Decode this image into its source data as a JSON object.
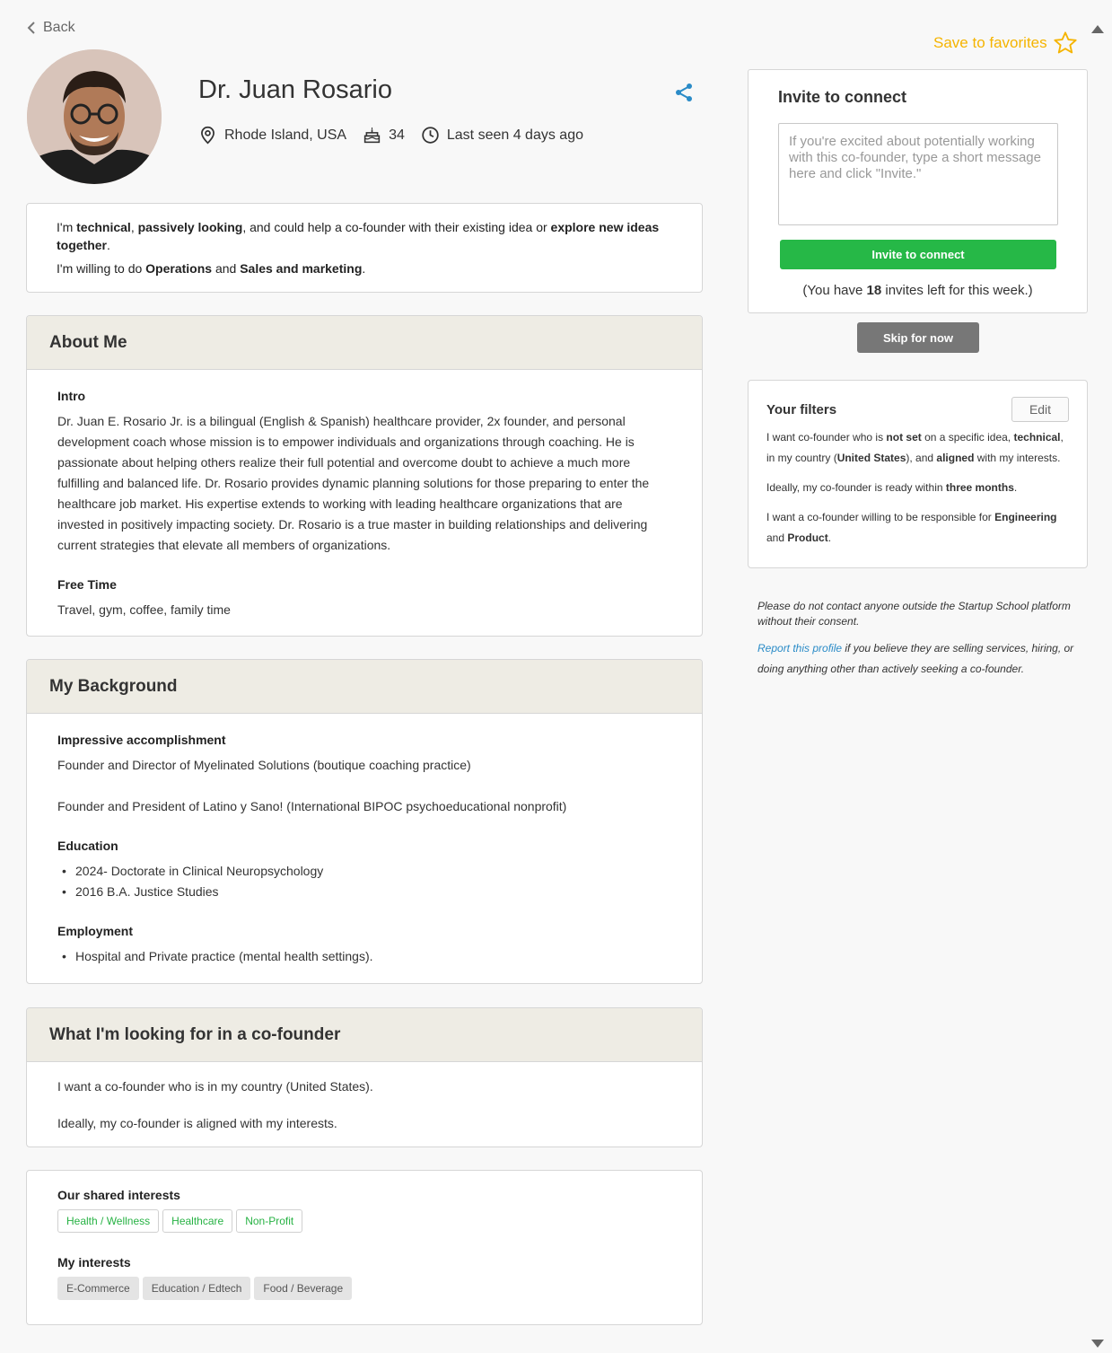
{
  "nav": {
    "back_label": "Back"
  },
  "profile": {
    "name": "Dr. Juan Rosario",
    "location": "Rhode Island, USA",
    "age": "34",
    "last_seen": "Last seen 4 days ago"
  },
  "summary": {
    "line1_a": "I'm ",
    "line1_b": "technical",
    "line1_c": ", ",
    "line1_d": "passively looking",
    "line1_e": ", and could help a co-founder with their existing idea or ",
    "line1_f": "explore new ideas together",
    "line1_g": ".",
    "line2_a": "I'm willing to do ",
    "line2_b": "Operations",
    "line2_c": " and ",
    "line2_d": "Sales and marketing",
    "line2_e": "."
  },
  "about": {
    "title": "About Me",
    "intro_label": "Intro",
    "intro_text": "Dr. Juan E. Rosario Jr. is a bilingual (English & Spanish) healthcare provider, 2x founder, and personal development coach whose mission is to empower individuals and organizations through coaching. He is passionate about helping others realize their full potential and overcome doubt to achieve a much more fulfilling and balanced life. Dr. Rosario provides dynamic planning solutions for those preparing to enter the healthcare job market. His expertise extends to working with leading healthcare organizations that are invested in positively impacting society. Dr. Rosario is a true master in building relationships and delivering current strategies that elevate all members of organizations.",
    "free_time_label": "Free Time",
    "free_time_text": "Travel, gym, coffee, family time"
  },
  "background": {
    "title": "My Background",
    "accomplishment_label": "Impressive accomplishment",
    "accomplishment_1": "Founder and Director of Myelinated Solutions (boutique coaching practice)",
    "accomplishment_2": "Founder and President of Latino y Sano! (International BIPOC psychoeducational nonprofit)",
    "education_label": "Education",
    "education": [
      "2024- Doctorate in Clinical Neuropsychology",
      "2016 B.A. Justice Studies"
    ],
    "employment_label": "Employment",
    "employment": [
      "Hospital and Private practice (mental health settings)."
    ]
  },
  "looking": {
    "title": "What I'm looking for in a co-founder",
    "line1": "I want a co-founder who is in my country (United States).",
    "line2": "Ideally, my co-founder is aligned with my interests."
  },
  "interests": {
    "shared_label": "Our shared interests",
    "shared": [
      "Health / Wellness",
      "Healthcare",
      "Non-Profit"
    ],
    "mine_label": "My interests",
    "mine": [
      "E-Commerce",
      "Education / Edtech",
      "Food / Beverage"
    ]
  },
  "sidebar": {
    "favorites_label": "Save to favorites",
    "invite_title": "Invite to connect",
    "invite_placeholder": "If you're excited about potentially working with this co-founder, type a short message here and click \"Invite.\"",
    "invite_button": "Invite to connect",
    "invites_left_a": "(You have ",
    "invites_left_count": "18",
    "invites_left_b": " invites left for this week.)",
    "skip_button": "Skip for now"
  },
  "filters": {
    "title": "Your filters",
    "edit_label": "Edit",
    "p1_a": "I want co-founder who is ",
    "p1_b": "not set",
    "p1_c": " on a specific idea, ",
    "p1_d": "technical",
    "p1_e": ", in my country (",
    "p1_f": "United States",
    "p1_g": "), and ",
    "p1_h": "aligned",
    "p1_i": " with my interests.",
    "p2_a": "Ideally, my co-founder is ready within ",
    "p2_b": "three months",
    "p2_c": ".",
    "p3_a": "I want a co-founder willing to be responsible for ",
    "p3_b": "Engineering",
    "p3_c": " and ",
    "p3_d": "Product",
    "p3_e": "."
  },
  "notice": {
    "text1": "Please do not contact anyone outside the Startup School platform without their consent.",
    "report_link": "Report this profile",
    "text2": " if you believe they are selling services, hiring, or doing anything other than actively seeking a co-founder."
  },
  "colors": {
    "accent_green": "#26b847",
    "favorite_yellow": "#f5b400",
    "link_blue": "#2a8bc7",
    "header_beige": "#eeece4"
  },
  "icons": [
    "chevron-left-icon",
    "location-pin-icon",
    "cake-icon",
    "clock-icon",
    "share-icon",
    "star-icon"
  ]
}
